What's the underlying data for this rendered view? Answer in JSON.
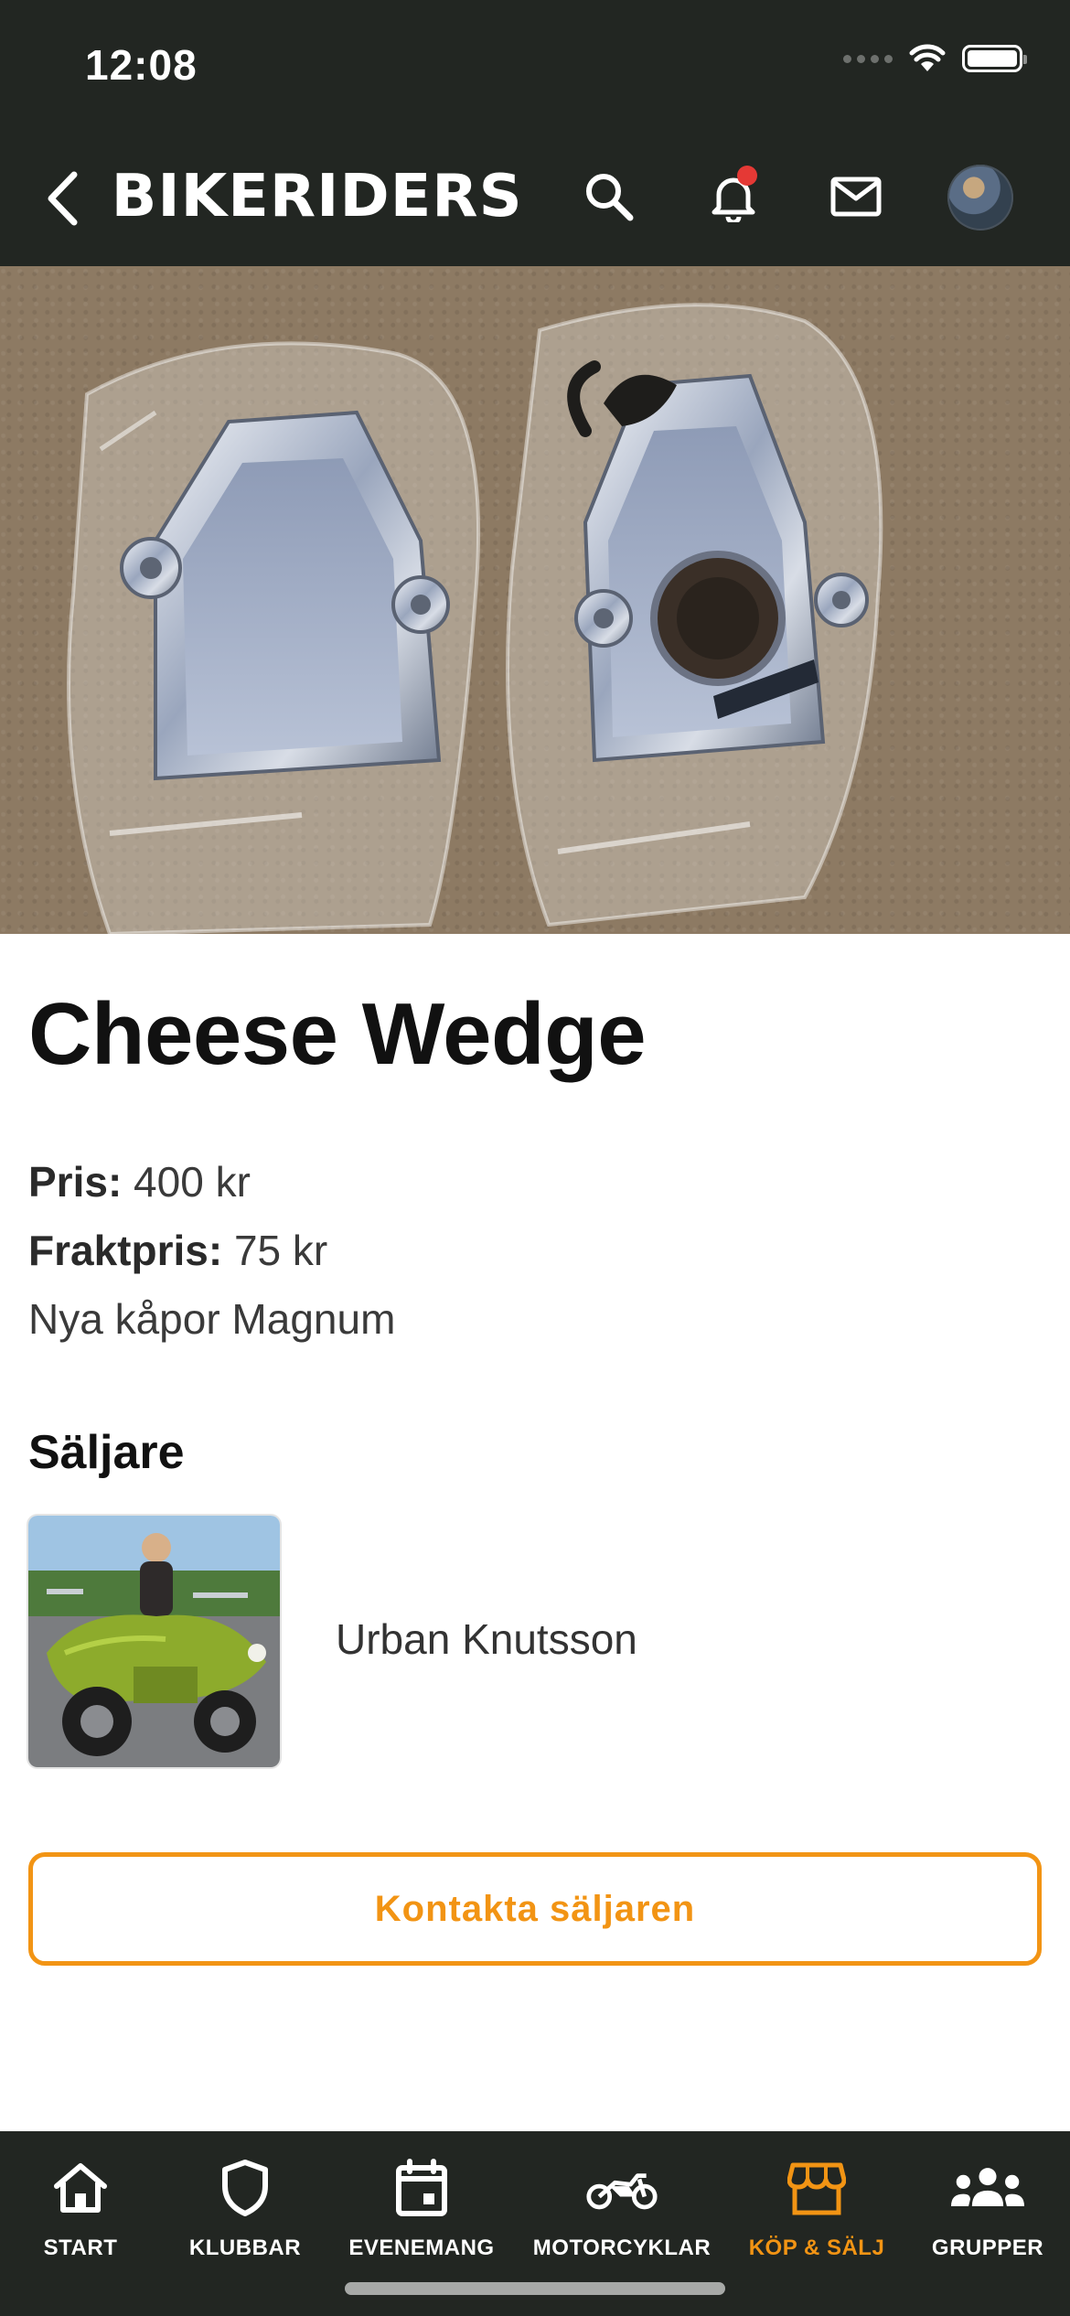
{
  "status": {
    "time": "12:08"
  },
  "header": {
    "brand": "BIKERIDERS"
  },
  "product": {
    "title": "Cheese Wedge",
    "price_label": "Pris:",
    "price_value": "400 kr",
    "shipping_label": "Fraktpris:",
    "shipping_value": "75 kr",
    "description": "Nya kåpor Magnum"
  },
  "seller": {
    "heading": "Säljare",
    "name": "Urban Knutsson"
  },
  "contact_button": "Kontakta säljaren",
  "nav": {
    "items": [
      {
        "label": "START",
        "icon": "home-icon"
      },
      {
        "label": "KLUBBAR",
        "icon": "shield-icon"
      },
      {
        "label": "EVENEMANG",
        "icon": "calendar-icon"
      },
      {
        "label": "MOTORCYKLAR",
        "icon": "motorcycle-icon"
      },
      {
        "label": "KÖP & SÄLJ",
        "icon": "store-icon"
      },
      {
        "label": "GRUPPER",
        "icon": "groups-icon"
      }
    ],
    "active": "KÖP & SÄLJ"
  },
  "colors": {
    "accent": "#f29414",
    "bar": "#222622",
    "notification": "#e53935"
  }
}
